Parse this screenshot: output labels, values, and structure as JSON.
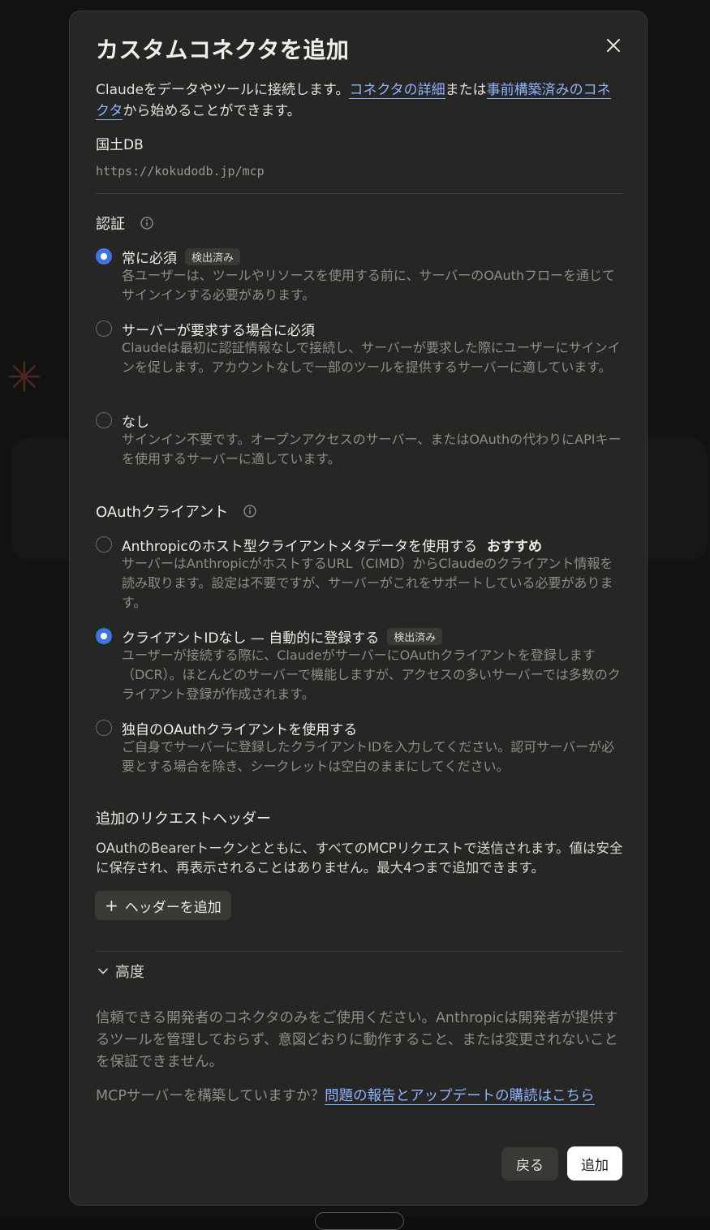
{
  "dialog": {
    "title": "カスタムコネクタを追加",
    "intro_pre": "Claudeをデータやツールに接続します。",
    "intro_link1": "コネクタの詳細",
    "intro_mid": "または",
    "intro_link2": "事前構築済みのコネクタ",
    "intro_post": "から始めることができます。",
    "connector_name": "国土DB",
    "connector_url": "https://kokudodb.jp/mcp"
  },
  "auth": {
    "heading": "認証",
    "options": [
      {
        "label": "常に必須",
        "badge": "検出済み",
        "selected": true,
        "desc": "各ユーザーは、ツールやリソースを使用する前に、サーバーのOAuthフローを通じてサインインする必要があります。"
      },
      {
        "label": "サーバーが要求する場合に必須",
        "selected": false,
        "desc": "Claudeは最初に認証情報なしで接続し、サーバーが要求した際にユーザーにサインインを促します。アカウントなしで一部のツールを提供するサーバーに適しています。"
      },
      {
        "label": "なし",
        "selected": false,
        "desc": "サインイン不要です。オープンアクセスのサーバー、またはOAuthの代わりにAPIキーを使用するサーバーに適しています。"
      }
    ]
  },
  "oauth": {
    "heading": "OAuthクライアント",
    "options": [
      {
        "label": "Anthropicのホスト型クライアントメタデータを使用する",
        "tag": "おすすめ",
        "selected": false,
        "desc": "サーバーはAnthropicがホストするURL（CIMD）からClaudeのクライアント情報を読み取ります。設定は不要ですが、サーバーがこれをサポートしている必要があります。"
      },
      {
        "label": "クライアントIDなし — 自動的に登録する",
        "badge": "検出済み",
        "selected": true,
        "desc": "ユーザーが接続する際に、ClaudeがサーバーにOAuthクライアントを登録します（DCR）。ほとんどのサーバーで機能しますが、アクセスの多いサーバーでは多数のクライアント登録が作成されます。"
      },
      {
        "label": "独自のOAuthクライアントを使用する",
        "selected": false,
        "desc": "ご自身でサーバーに登録したクライアントIDを入力してください。認可サーバーが必要とする場合を除き、シークレットは空白のままにしてください。"
      }
    ]
  },
  "headers": {
    "heading": "追加のリクエストヘッダー",
    "desc": "OAuthのBearerトークンとともに、すべてのMCPリクエストで送信されます。値は安全に保存され、再表示されることはありません。最大4つまで追加できます。",
    "add_label": "ヘッダーを追加"
  },
  "advanced": {
    "label": "高度",
    "warning": "信頼できる開発者のコネクタのみをご使用ください。Anthropicは開発者が提供するツールを管理しておらず、意図どおりに動作すること、または変更されないことを保証できません。",
    "mcp_pre": "MCPサーバーを構築していますか？",
    "mcp_link": "問題の報告とアップデートの購読はこちら"
  },
  "buttons": {
    "back": "戻る",
    "add": "追加"
  },
  "colors": {
    "accent": "#3f74de",
    "link": "#8fb4ff",
    "panel": "#262624"
  }
}
